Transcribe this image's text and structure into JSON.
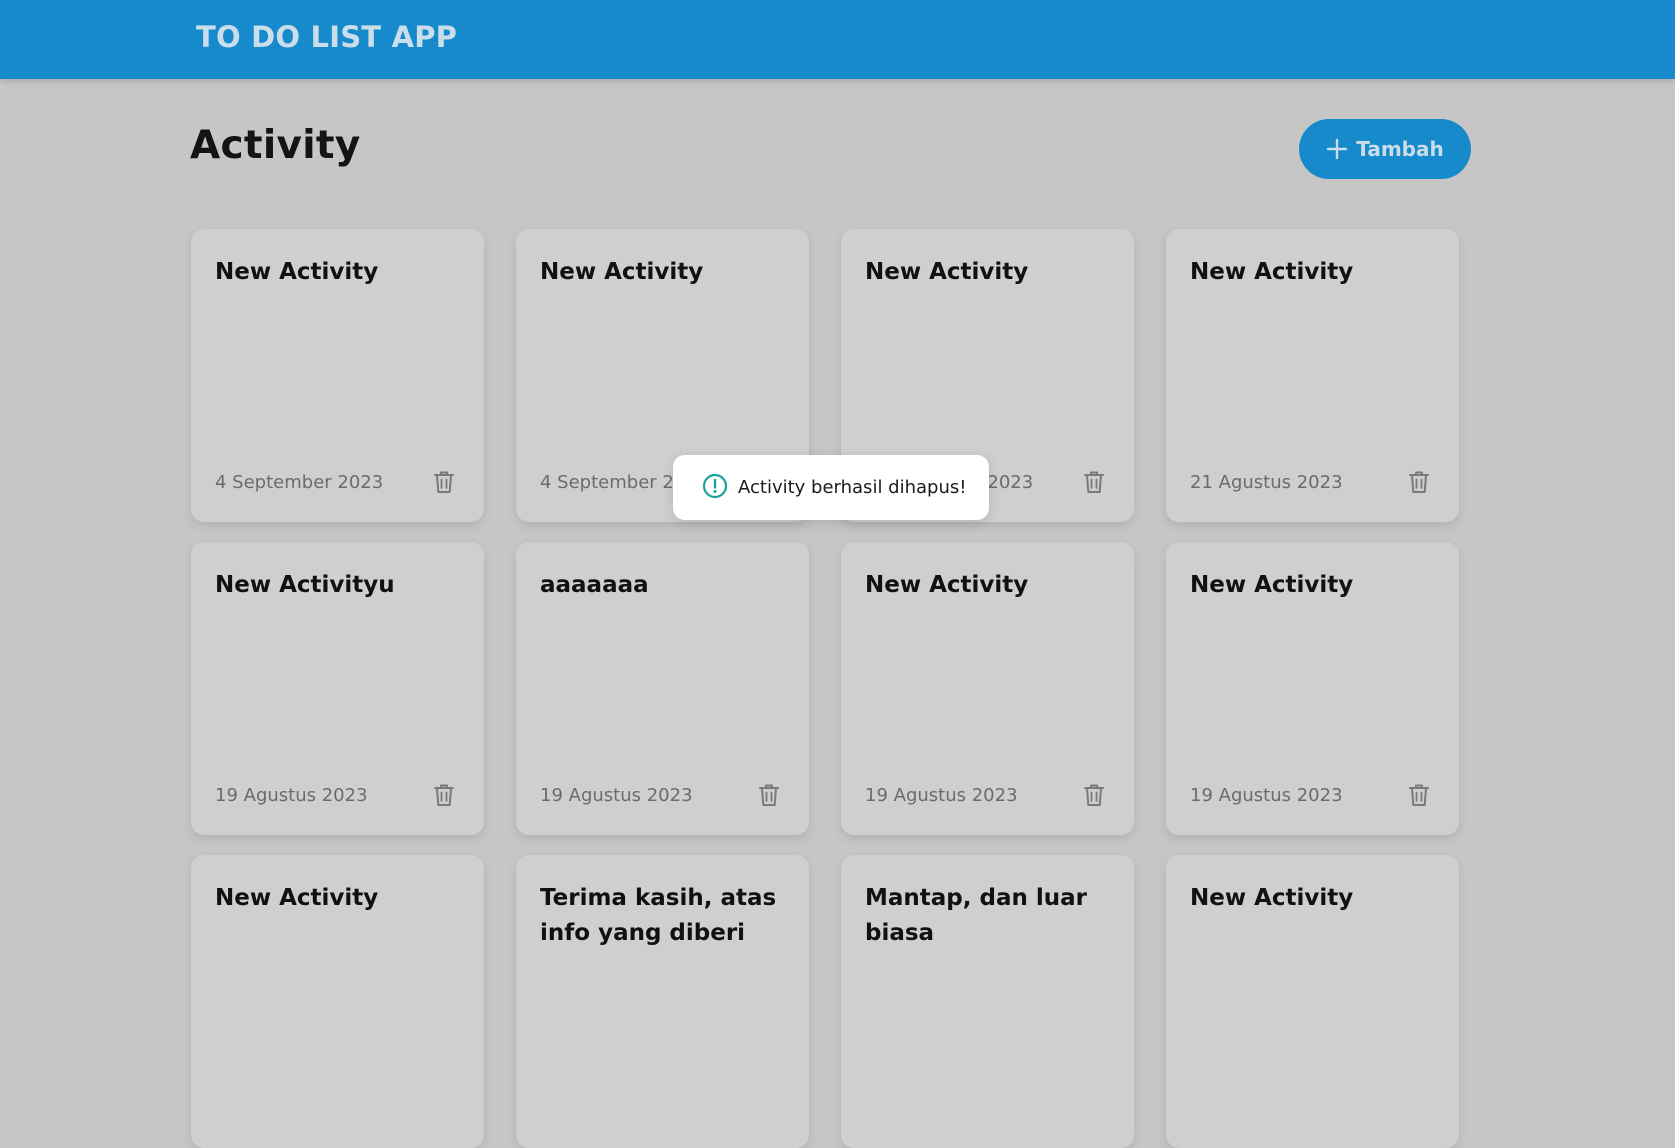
{
  "header": {
    "app_title": "TO DO LIST APP"
  },
  "page": {
    "title": "Activity"
  },
  "toolbar": {
    "add_label": "Tambah",
    "add_icon": "plus-icon"
  },
  "colors": {
    "brand": "#168acb",
    "toast_icon": "#1aa39a"
  },
  "activities": [
    {
      "title": "New Activity",
      "date": "4 September 2023"
    },
    {
      "title": "New Activity",
      "date": "4 September 2023"
    },
    {
      "title": "New Activity",
      "date": "4 September 2023"
    },
    {
      "title": "New Activity",
      "date": "21 Agustus 2023"
    },
    {
      "title": "New Activityu",
      "date": "19 Agustus 2023"
    },
    {
      "title": "aaaaaaa",
      "date": "19 Agustus 2023"
    },
    {
      "title": "New Activity",
      "date": "19 Agustus 2023"
    },
    {
      "title": "New Activity",
      "date": "19 Agustus 2023"
    },
    {
      "title": "New Activity",
      "date": ""
    },
    {
      "title": "Terima kasih, atas info yang diberi",
      "date": ""
    },
    {
      "title": "Mantap, dan luar biasa",
      "date": ""
    },
    {
      "title": "New Activity",
      "date": ""
    }
  ],
  "toast": {
    "message": "Activity berhasil dihapus!",
    "icon": "alert-circle-icon"
  }
}
